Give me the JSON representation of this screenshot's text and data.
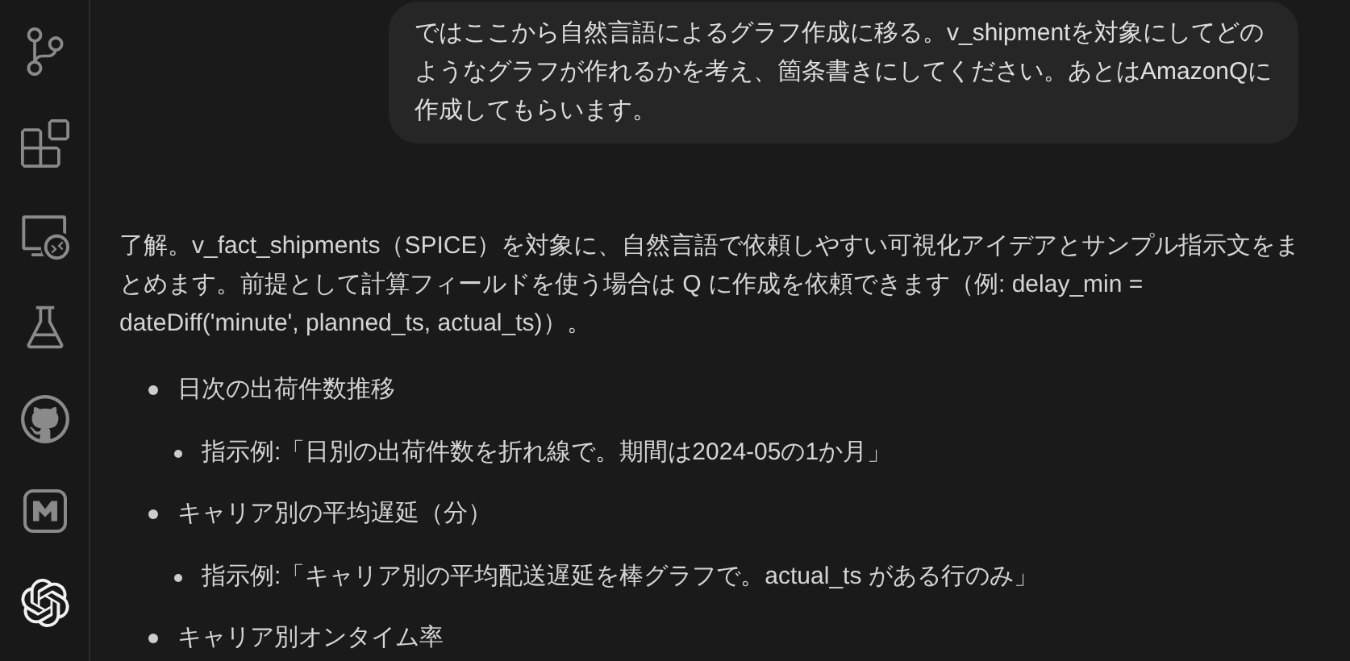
{
  "sidebar": {
    "items": [
      {
        "kind": "source-control",
        "selected": false
      },
      {
        "kind": "extensions",
        "selected": false
      },
      {
        "kind": "remote",
        "selected": false
      },
      {
        "kind": "testing",
        "selected": false
      },
      {
        "kind": "github",
        "selected": false
      },
      {
        "kind": "m-logo",
        "selected": false
      },
      {
        "kind": "knot",
        "selected": true
      }
    ]
  },
  "user_message": "ではここから自然言語によるグラフ作成に移る。v_shipmentを対象にしてどのようなグラフが作れるかを考え、箇条書きにしてください。あとはAmazonQに作成してもらいます。",
  "reply": {
    "paragraph": "了解。v_fact_shipments（SPICE）を対象に、自然言語で依頼しやすい可視化アイデアとサンプル指示文をまとめます。前提として計算フィールドを使う場合は Q に作成を依頼できます（例: delay_min = dateDiff('minute', planned_ts, actual_ts)）。",
    "bullets": [
      {
        "text": "日次の出荷件数推移",
        "children": [
          {
            "text": "指示例:「日別の出荷件数を折れ線で。期間は2024-05の1か月」"
          }
        ]
      },
      {
        "text": "キャリア別の平均遅延（分）",
        "children": [
          {
            "text": "指示例:「キャリア別の平均配送遅延を棒グラフで。actual_ts がある行のみ」"
          }
        ]
      },
      {
        "text": "キャリア別オンタイム率"
      }
    ]
  }
}
